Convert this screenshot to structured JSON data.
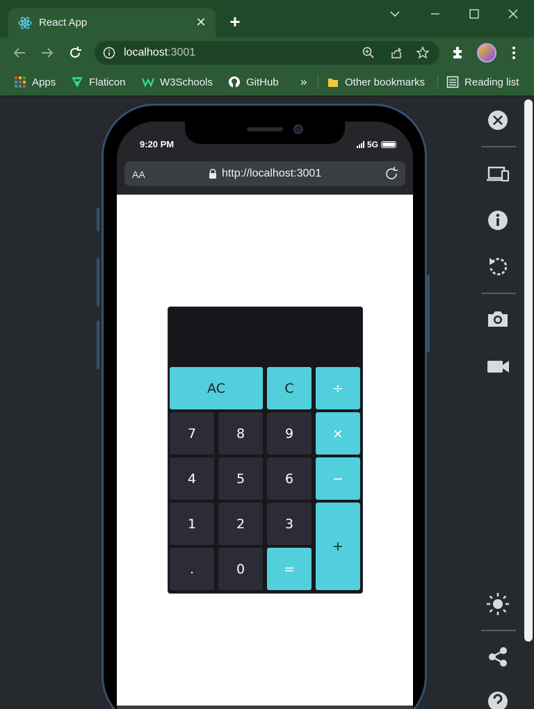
{
  "browser": {
    "tab_title": "React App",
    "url_host": "localhost",
    "url_port": ":3001"
  },
  "bookmarks": {
    "items": [
      {
        "label": "Apps",
        "icon": "apps-grid-icon"
      },
      {
        "label": "Flaticon",
        "icon": "flaticon-logo-icon"
      },
      {
        "label": "W3Schools",
        "icon": "w3schools-logo-icon"
      },
      {
        "label": "GitHub",
        "icon": "github-logo-icon"
      }
    ],
    "overflow": "»",
    "other": "Other bookmarks",
    "reading_list": "Reading list"
  },
  "device": {
    "status_time": "9:20 PM",
    "network": "5G",
    "mobile_aa": "AA",
    "mobile_url": "http://localhost:3001"
  },
  "calculator": {
    "display": "",
    "keys": {
      "ac": "AC",
      "c": "C",
      "divide": "÷",
      "k7": "7",
      "k8": "8",
      "k9": "9",
      "multiply": "×",
      "k4": "4",
      "k5": "5",
      "k6": "6",
      "minus": "−",
      "k1": "1",
      "k2": "2",
      "k3": "3",
      "plus": "+",
      "dot": ".",
      "k0": "0",
      "equals": "="
    },
    "colors": {
      "accent": "#52cfdd",
      "dark_key": "#2b2c35",
      "body": "#16181c"
    }
  },
  "colors": {
    "chrome": "#2b5a35",
    "titlebar": "#1f4a2a",
    "devtools": "#26292d"
  }
}
